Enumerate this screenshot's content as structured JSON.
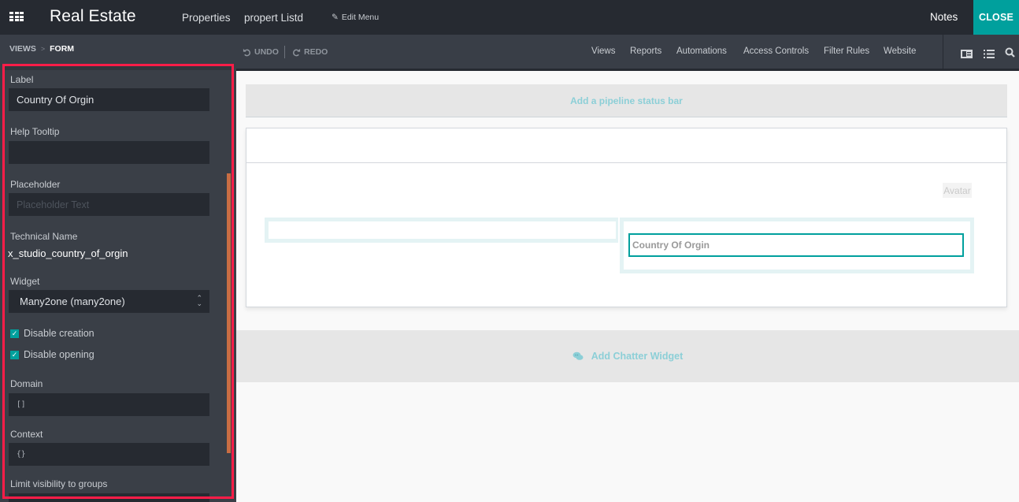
{
  "topbar": {
    "app_title": "Real Estate",
    "menu": [
      "Properties",
      "propert Listd"
    ],
    "edit_menu": "Edit Menu",
    "notes": "Notes",
    "close": "CLOSE"
  },
  "subbar": {
    "breadcrumb": [
      "VIEWS",
      "FORM"
    ],
    "undo": "UNDO",
    "redo": "REDO",
    "menu": [
      "Views",
      "Reports",
      "Automations",
      "Access Controls",
      "Filter Rules",
      "Website"
    ],
    "view_icons": [
      "form-view-icon",
      "list-view-icon",
      "search-view-icon"
    ]
  },
  "sidebar": {
    "label": {
      "title": "Label",
      "value": "Country Of Orgin"
    },
    "help_tooltip": {
      "title": "Help Tooltip",
      "value": ""
    },
    "placeholder": {
      "title": "Placeholder",
      "placeholder": "Placeholder Text"
    },
    "technical_name": {
      "title": "Technical Name",
      "value": "x_studio_country_of_orgin"
    },
    "widget": {
      "title": "Widget",
      "value": "Many2one (many2one)"
    },
    "checkboxes": [
      {
        "label": "Disable creation",
        "checked": true
      },
      {
        "label": "Disable opening",
        "checked": true
      }
    ],
    "domain": {
      "title": "Domain",
      "value": "[]"
    },
    "context": {
      "title": "Context",
      "value": "{}"
    },
    "limit_visibility": {
      "title": "Limit visibility to groups"
    }
  },
  "canvas": {
    "pipeline": "Add a pipeline status bar",
    "avatar": "Avatar",
    "field_label": "Country Of Orgin",
    "chatter": "Add Chatter Widget"
  },
  "colors": {
    "accent": "#00a09d",
    "highlight": "#ff1d48",
    "scrollbar": "#c86d43",
    "hint_text": "#8ccfd7"
  }
}
